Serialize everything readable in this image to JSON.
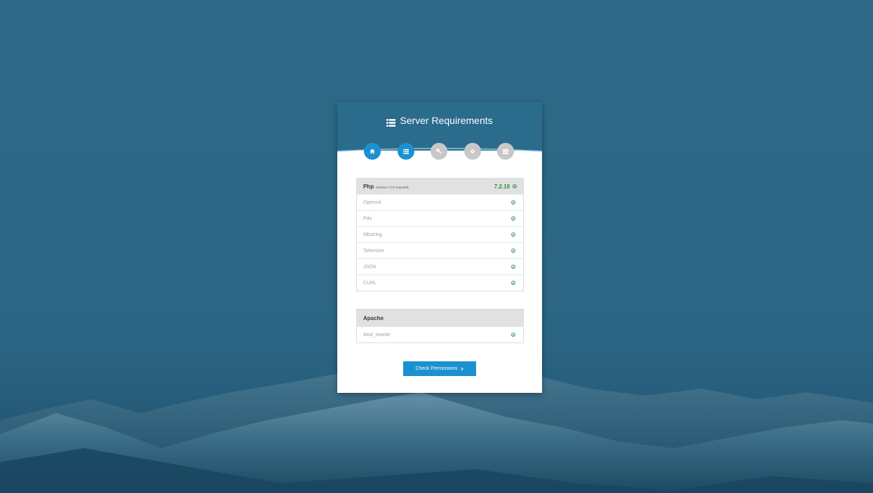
{
  "title": "Server Requirements",
  "icons": {
    "title": "list-icon",
    "steps": [
      "home-icon",
      "list-icon",
      "key-icon",
      "gear-icon",
      "server-icon"
    ],
    "status": "check-circle-icon",
    "button": "chevron-right-icon"
  },
  "steps": [
    {
      "name": "welcome",
      "state": "done"
    },
    {
      "name": "requirements",
      "state": "done"
    },
    {
      "name": "permissions",
      "state": "pending"
    },
    {
      "name": "environment",
      "state": "pending"
    },
    {
      "name": "final",
      "state": "pending"
    }
  ],
  "php": {
    "name": "Php",
    "note": "(version 7.0.0 required)",
    "version": "7.2.19",
    "items": [
      "Openssl",
      "Pdo",
      "Mbstring",
      "Tokenizer",
      "JSON",
      "CURL"
    ]
  },
  "apache": {
    "name": "Apache",
    "items": [
      "Mod_rewrite"
    ]
  },
  "button": {
    "label": "Check Permissions"
  },
  "colors": {
    "accent": "#1a91d0",
    "header": "#2b6b8c",
    "success": "#2f9e44",
    "pending": "#c8c8c8"
  }
}
